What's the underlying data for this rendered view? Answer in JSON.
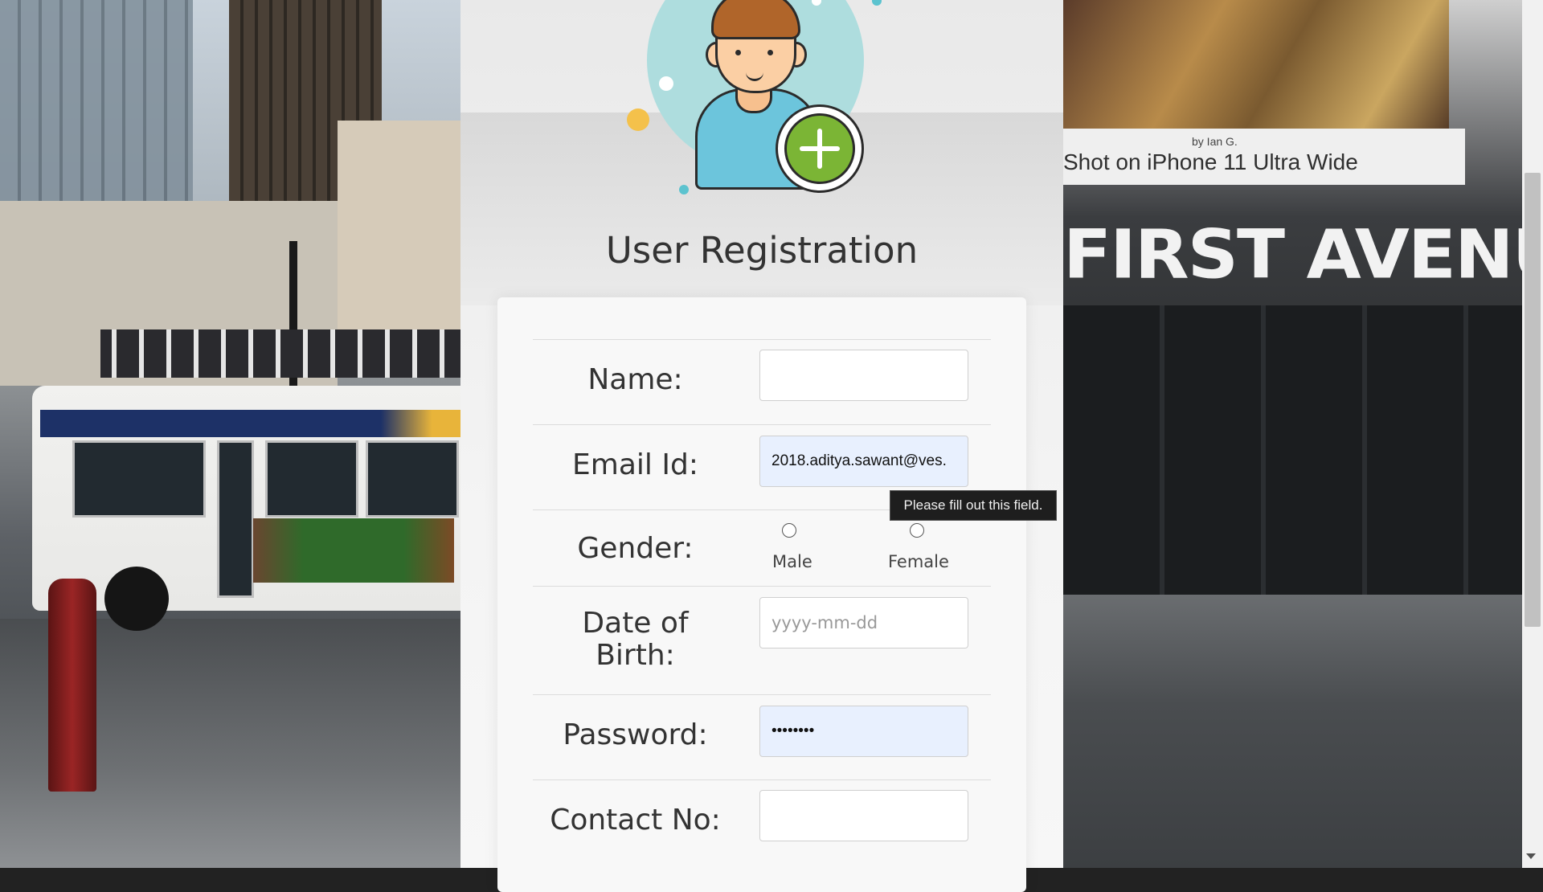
{
  "form": {
    "title": "User Registration",
    "fields": {
      "name": {
        "label": "Name:",
        "value": ""
      },
      "email": {
        "label": "Email Id:",
        "value": "2018.aditya.sawant@ves."
      },
      "gender": {
        "label": "Gender:",
        "options": [
          "Male",
          "Female"
        ],
        "selected": null
      },
      "dob": {
        "label_line1": "Date of",
        "label_line2": "Birth:",
        "placeholder": "yyyy-mm-dd",
        "value": ""
      },
      "password": {
        "label": "Password:",
        "masked_value": "••••••••"
      },
      "contact": {
        "label": "Contact No:",
        "value": ""
      }
    },
    "validation_tooltip": "Please fill out this field."
  },
  "background": {
    "right_billboard_caption": "Shot on iPhone 11 Ultra Wide",
    "right_billboard_credit": "by Ian G.",
    "right_sign": "FIRST AVENUE",
    "colors": {
      "page_accent_plus": "#7bb535",
      "avatar_circle": "#aeddde",
      "autofill_bg": "#e8f0fe"
    }
  }
}
